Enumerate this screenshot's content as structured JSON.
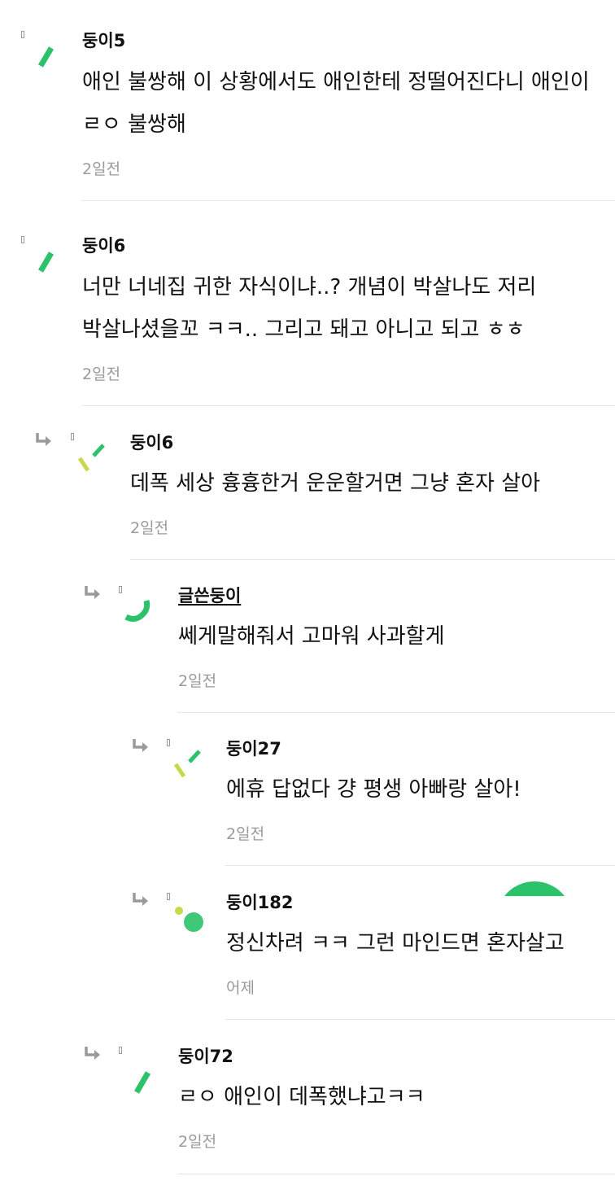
{
  "comments": [
    {
      "author": "둥이5",
      "body": "애인 불쌍해 이 상황에서도 애인한테 정떨어진다니 애인이 ㄹㅇ 불쌍해",
      "time": "2일전",
      "avatar_icon": "green-slash-icon",
      "is_reply": false,
      "is_writer": false
    },
    {
      "author": "둥이6",
      "body": "너만 너네집 귀한 자식이냐..? 개념이 박살나도 저리 박살나셨을꼬 ㅋㅋ.. 그리고 돼고 아니고 되고 ㅎㅎ",
      "time": "2일전",
      "avatar_icon": "green-slash-icon",
      "is_reply": false,
      "is_writer": false
    },
    {
      "author": "둥이6",
      "body": "데폭 세상 흉흉한거 운운할거면 그냥 혼자 살아",
      "time": "2일전",
      "avatar_icon": "confetti-icon",
      "is_reply": true,
      "is_writer": false
    },
    {
      "author": "글쓴둥이",
      "body": "쎄게말해줘서 고마워 사과할게",
      "time": "2일전",
      "avatar_icon": "green-arc-icon",
      "is_reply": true,
      "is_writer": true
    },
    {
      "author": "둥이27",
      "body": "에휴 답없다 걍 평생 아빠랑 살아!",
      "time": "2일전",
      "avatar_icon": "confetti-icon",
      "is_reply": true,
      "is_writer": false
    },
    {
      "author": "둥이182",
      "body": "정신차려 ㅋㅋ 그런 마인드면 혼자살고",
      "time": "어제",
      "avatar_icon": "green-dots-icon",
      "is_reply": true,
      "is_writer": false
    },
    {
      "author": "둥이72",
      "body": "ㄹㅇ 애인이 데폭했냐고ㅋㅋ",
      "time": "2일전",
      "avatar_icon": "green-slash-icon",
      "is_reply": true,
      "is_writer": false
    }
  ],
  "floating_badge": {
    "icon": "green-circle-badge-icon",
    "color": "#2bc26a"
  },
  "colors": {
    "brand_green": "#2bc26a",
    "lime": "#c8d84a",
    "meta_gray": "#9a9a9a",
    "divider": "#e6e6e6"
  }
}
